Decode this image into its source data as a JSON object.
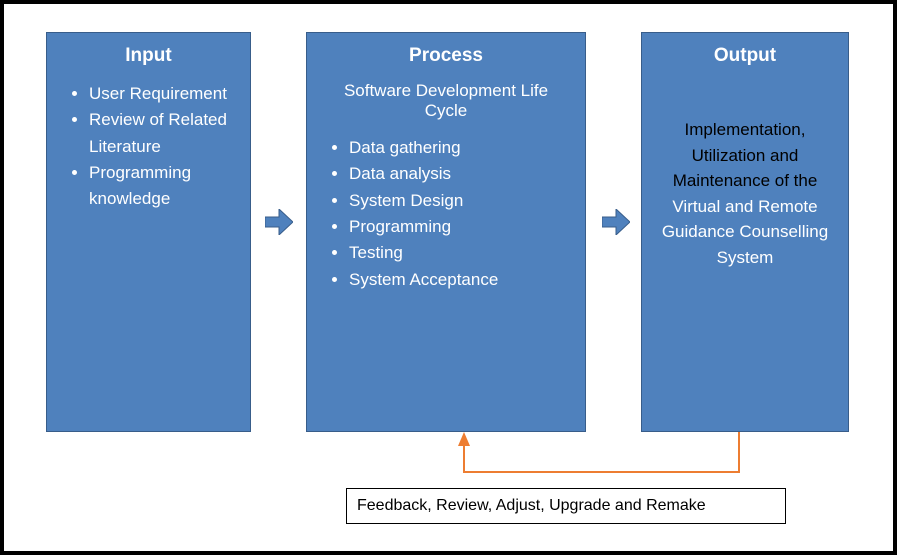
{
  "input": {
    "title": "Input",
    "items": [
      "User Requirement",
      "Review of Related Literature",
      "Programming knowledge"
    ]
  },
  "process": {
    "title": "Process",
    "subtitle": "Software Development Life Cycle",
    "items": [
      "Data gathering",
      "Data analysis",
      "System Design",
      "Programming",
      "Testing",
      "System Acceptance"
    ]
  },
  "output": {
    "title": "Output",
    "text_part1": "Implementation, Utilization and Maintenance of the ",
    "text_part2": "Virtual and Remote Guidance Counselling System"
  },
  "feedback": {
    "label": "Feedback, Review, Adjust, Upgrade and Remake"
  }
}
